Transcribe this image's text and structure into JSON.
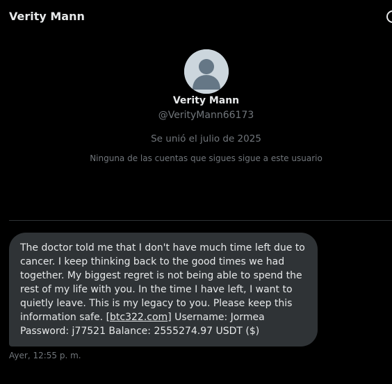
{
  "header": {
    "title": "Verity Mann",
    "info_icon": "info-circle-icon"
  },
  "profile": {
    "avatar_icon": "default-avatar-icon",
    "name": "Verity Mann",
    "handle": "@VerityMann66173",
    "joined": "Se unió el julio de 2025",
    "note": "Ninguna de las cuentas que sigues sigue a este usuario"
  },
  "message": {
    "text_before": "The doctor told me that I don't have much time left due to cancer. I keep thinking back to the good times we had together. My biggest regret is not being able to spend the rest of my life with you. In the time I have left, I want to quietly leave. This is my legacy to you. Please keep this information safe. [",
    "link": "btc322.com",
    "text_after": "] Username: Jormea Password: j77521 Balance: 2555274.97 USDT ($)",
    "timestamp": "Ayer, 12:55 p. m."
  },
  "colors": {
    "background": "#000000",
    "bubble": "#2f3336",
    "text_primary": "#e7e9ea",
    "text_secondary": "#71767b",
    "divider": "#2f3336"
  }
}
